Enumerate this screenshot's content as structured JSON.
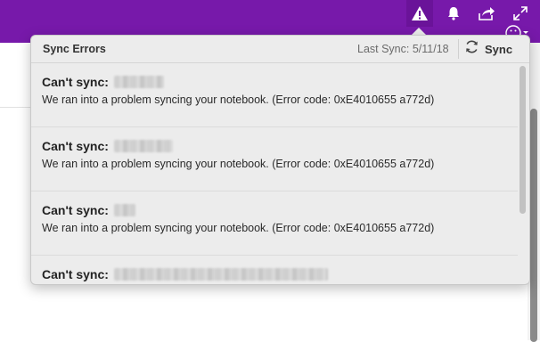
{
  "topbar": {
    "icons": [
      "warning-icon",
      "bell-icon",
      "share-icon",
      "expand-icon",
      "smiley-icon"
    ],
    "color": "#7719aa"
  },
  "popup": {
    "title": "Sync Errors",
    "last_sync": "Last Sync: 5/11/18",
    "sync_label": "Sync",
    "sync_icon": "refresh-icon"
  },
  "errors": [
    {
      "prefix": "Can't sync:",
      "message": "We ran into a problem syncing your notebook. (Error code: 0xE4010655 a772d)"
    },
    {
      "prefix": "Can't sync:",
      "message": "We ran into a problem syncing your notebook. (Error code: 0xE4010655 a772d)"
    },
    {
      "prefix": "Can't sync:",
      "message": "We ran into a problem syncing your notebook. (Error code: 0xE4010655 a772d)"
    },
    {
      "prefix": "Can't sync:",
      "message": ""
    }
  ]
}
